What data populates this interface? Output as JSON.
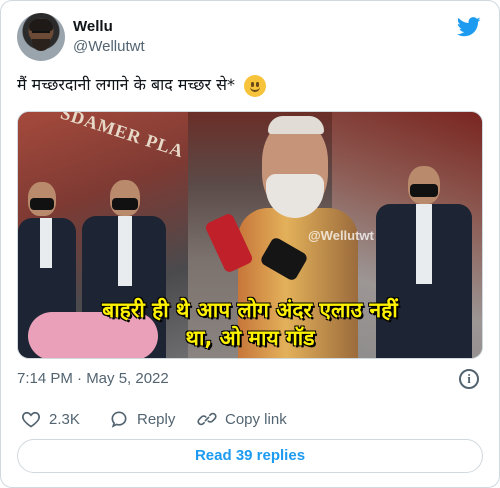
{
  "author": {
    "display_name": "Wellu",
    "handle": "@Wellutwt"
  },
  "tweet": {
    "text": "मैं मच्छरदानी लगाने के बाद मच्छर से*",
    "emoji": "slightly-smiling-face"
  },
  "media": {
    "sign_text": "SDAMER PLA",
    "watermark": "@Wellutwt",
    "subtitle_line1": "बाहरी ही थे आप लोग अंदर एलाउ नहीं",
    "subtitle_line2": "था, ओ माय गॉड"
  },
  "meta": {
    "timestamp": "7:14 PM · May 5, 2022"
  },
  "actions": {
    "likes_count": "2.3K",
    "reply_label": "Reply",
    "copy_link_label": "Copy link"
  },
  "replies_button_label": "Read 39 replies",
  "colors": {
    "brand_blue": "#1d9bf0",
    "secondary_text": "#536471",
    "subtitle_yellow": "#fff200"
  }
}
